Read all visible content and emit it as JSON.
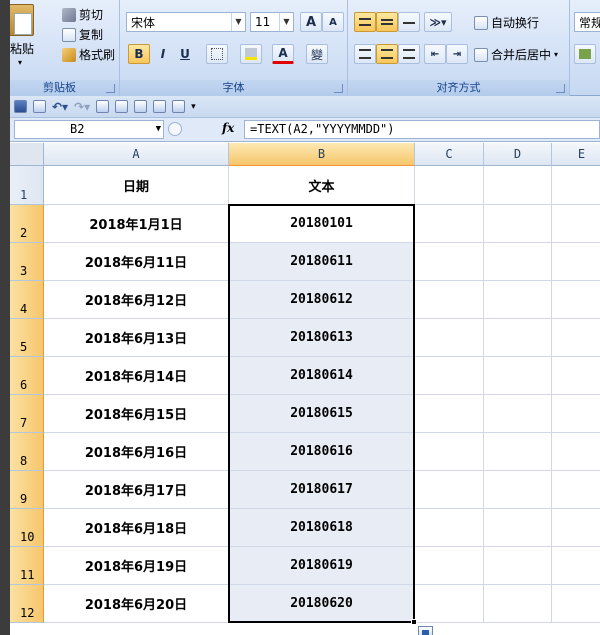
{
  "ribbon": {
    "clipboard": {
      "paste": "粘贴",
      "cut": "剪切",
      "copy": "复制",
      "format_painter": "格式刷",
      "group_label": "剪贴板"
    },
    "font": {
      "family": "宋体",
      "size": "11",
      "grow": "A",
      "shrink": "A",
      "bold": "B",
      "italic": "I",
      "underline": "U",
      "font_color": "A",
      "phonetic": "變",
      "group_label": "字体"
    },
    "alignment": {
      "wrap_text": "自动换行",
      "merge_center": "合并后居中",
      "group_label": "对齐方式"
    },
    "number": {
      "format": "常规"
    }
  },
  "formula_bar": {
    "name_box": "B2",
    "fx": "fx",
    "formula": "=TEXT(A2,\"YYYYMMDD\")"
  },
  "columns": [
    "A",
    "B",
    "C",
    "D",
    "E"
  ],
  "rows": [
    "1",
    "2",
    "3",
    "4",
    "5",
    "6",
    "7",
    "8",
    "9",
    "10",
    "11",
    "12"
  ],
  "headers": {
    "col_a": "日期",
    "col_b": "文本"
  },
  "data_rows": [
    {
      "date": "2018年1月1日",
      "text": "20180101"
    },
    {
      "date": "2018年6月11日",
      "text": "20180611"
    },
    {
      "date": "2018年6月12日",
      "text": "20180612"
    },
    {
      "date": "2018年6月13日",
      "text": "20180613"
    },
    {
      "date": "2018年6月14日",
      "text": "20180614"
    },
    {
      "date": "2018年6月15日",
      "text": "20180615"
    },
    {
      "date": "2018年6月16日",
      "text": "20180616"
    },
    {
      "date": "2018年6月17日",
      "text": "20180617"
    },
    {
      "date": "2018年6月18日",
      "text": "20180618"
    },
    {
      "date": "2018年6月19日",
      "text": "20180619"
    },
    {
      "date": "2018年6月20日",
      "text": "20180620"
    }
  ],
  "colors": {
    "selection_fill": "#e8edf5",
    "header_highlight": "#f6c66b",
    "ribbon_bg": "#d3e1f6"
  }
}
